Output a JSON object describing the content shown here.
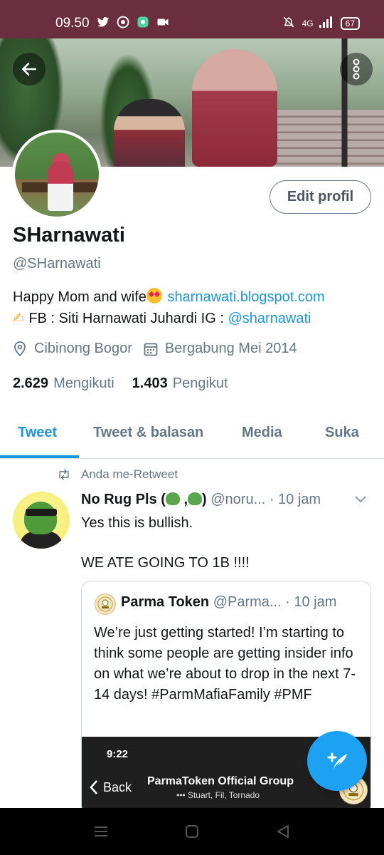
{
  "status_bar": {
    "time": "09.50",
    "network": "4G",
    "battery": "67",
    "icons_left": [
      "twitter-icon",
      "chrome-icon",
      "app-icon",
      "video-icon"
    ],
    "icons_right": [
      "mute-icon",
      "signal-icon",
      "signal-icon"
    ]
  },
  "profile": {
    "display_name": "SHarnawati",
    "handle": "@SHarnawati",
    "edit_label": "Edit profil",
    "bio_line1_text": "Happy Mom and wife",
    "bio_emoji": "heart-eyes-emoji",
    "bio_link1": "sharnawati.blogspot.com",
    "bio_line2_emoji": "writing-hand-emoji",
    "bio_line2_text": "FB : Siti Harnawati Juhardi IG : ",
    "bio_link2": "@sharnawati",
    "location": "Cibinong Bogor",
    "joined": "Bergabung Mei 2014",
    "following_count": "2.629",
    "following_label": "Mengikuti",
    "followers_count": "1.403",
    "followers_label": "Pengikut"
  },
  "tabs": [
    {
      "label": "Tweet",
      "active": true
    },
    {
      "label": "Tweet & balasan",
      "active": false
    },
    {
      "label": "Media",
      "active": false
    },
    {
      "label": "Suka",
      "active": false
    }
  ],
  "tweet": {
    "retweet_label": "Anda me-Retweet",
    "author_name": "No Rug Pls (",
    "author_name_sep": " ,",
    "author_name_end": ")",
    "author_handle": "@noru...",
    "time": "· 10 jam",
    "text": "Yes this is bullish.\n\nWE ATE GOING TO 1B !!!!",
    "quote": {
      "name": "Parma Token",
      "handle": "@Parma...",
      "time": "· 10 jam",
      "text": "We’re just getting started!  I’m starting to think some people are getting insider info on what we’re about to drop in the next 7-14 days! #ParmMafiaFamily #PMF",
      "media": {
        "time": "9:22",
        "back_label": "Back",
        "title": "ParmaToken Official Group",
        "subtitle": "••• Stuart, Fil, Tornado"
      }
    }
  },
  "colors": {
    "accent": "#1b95e0",
    "status_bar": "#6b2e3f",
    "muted_text": "#657786",
    "fab": "#1da1f2"
  }
}
